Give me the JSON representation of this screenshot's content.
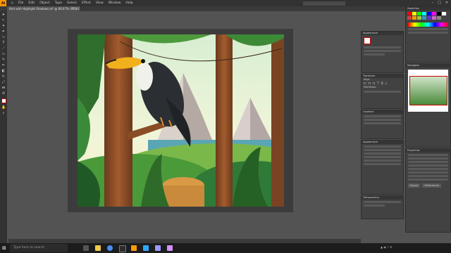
{
  "app": {
    "logo": "Ai",
    "logo_color": "#ff9a00"
  },
  "menu": [
    "File",
    "Edit",
    "Object",
    "Type",
    "Select",
    "Effect",
    "View",
    "Window",
    "Help"
  ],
  "document": {
    "tab_title": "Bird with Highlight Shadows.ai* @ 66.67% (RGB/GPU Preview)"
  },
  "panels": {
    "swatches": "Swatches",
    "layers": "Layers",
    "appearance": "Appearance",
    "properties": "Properties",
    "transparency": "Transparency",
    "stroke": "Stroke",
    "gradient": "Gradient",
    "transform": "Transform",
    "align": "Align",
    "pathfinder": "Pathfinder",
    "navigator": "Navigator"
  },
  "buttons": {
    "quick_export": "Export",
    "preferences": "Preferences"
  },
  "taskbar": {
    "search_placeholder": "Type here to search"
  },
  "icons": [
    "home-icon",
    "search-icon",
    "selection-tool-icon",
    "pen-tool-icon",
    "type-tool-icon",
    "eyedropper-icon",
    "windows-start-icon",
    "file-explorer-icon",
    "chrome-icon",
    "illustrator-icon",
    "photoshop-icon",
    "premiere-icon"
  ]
}
